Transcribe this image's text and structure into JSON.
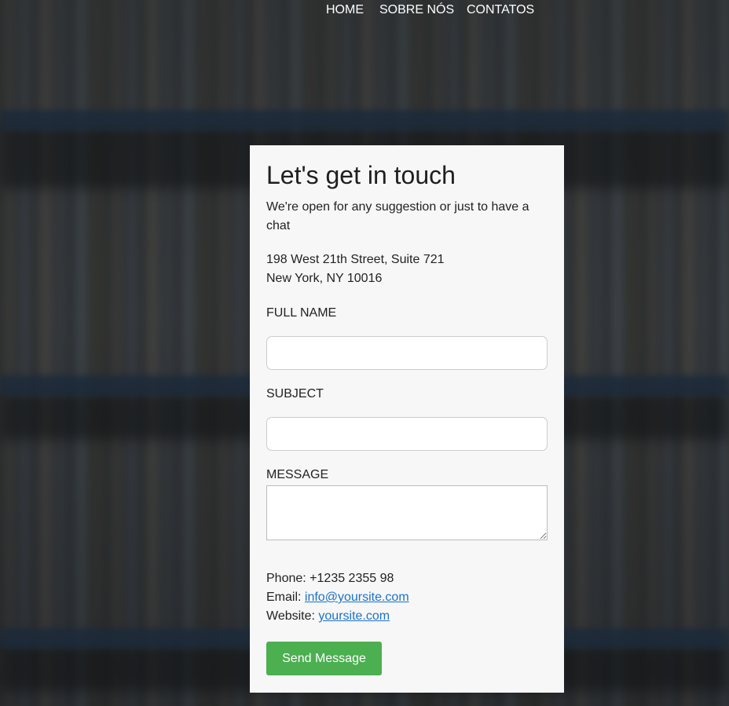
{
  "nav": {
    "items": [
      {
        "label": "HOME"
      },
      {
        "label": "SOBRE NÓS"
      },
      {
        "label": "CONTATOS"
      }
    ]
  },
  "card": {
    "title": "Let's get in touch",
    "intro": "We're open for any suggestion or just to have a chat",
    "address_line1": "198 West 21th Street, Suite 721",
    "address_line2": "New York, NY 10016",
    "form": {
      "full_name_label": "FULL NAME",
      "full_name_value": "",
      "subject_label": "SUBJECT",
      "subject_value": "",
      "message_label": "MESSAGE",
      "message_value": ""
    },
    "contact": {
      "phone_label": "Phone:",
      "phone_value": "+1235 2355 98",
      "email_label": "Email:",
      "email_value": "info@yoursite.com",
      "website_label": "Website:",
      "website_value": "yoursite.com"
    },
    "send_label": "Send Message"
  },
  "colors": {
    "accent_button": "#4caf50",
    "link": "#1a73c9",
    "card_bg": "#f7f7f7"
  }
}
